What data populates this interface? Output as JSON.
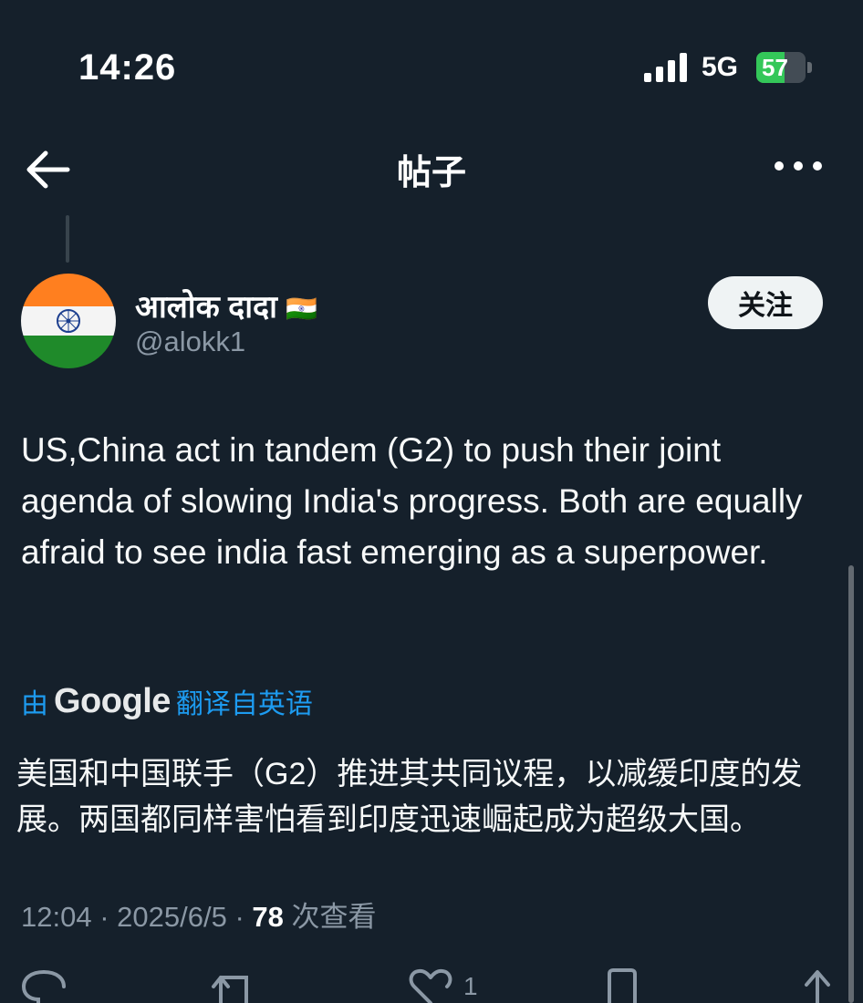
{
  "status_bar": {
    "time": "14:26",
    "network": "5G",
    "battery": "57",
    "battery_level": 0.57
  },
  "header": {
    "title": "帖子",
    "back_icon": "arrow-left-icon",
    "more_icon": "more-horizontal-icon"
  },
  "author": {
    "name": "आलोक दादा",
    "flag": "🇮🇳",
    "handle": "@alokk1",
    "follow_label": "关注",
    "avatar_icon": "india-flag-avatar"
  },
  "post": {
    "text": "US,China act in tandem (G2) to push their joint agenda of slowing India's progress. Both are equally afraid to see india fast emerging as a superpower."
  },
  "translation": {
    "by": "由",
    "provider": "Google",
    "label": "翻译自英语",
    "text": "美国和中国联手（G2）推进其共同议程，以减缓印度的发展。两国都同样害怕看到印度迅速崛起成为超级大国。"
  },
  "meta": {
    "time": "12:04",
    "sep1": "·",
    "date": "2025/6/5",
    "sep2": "·",
    "views": "78",
    "views_label": "次查看"
  },
  "actions": {
    "reply_icon": "reply-icon",
    "repost_icon": "repost-icon",
    "like_icon": "heart-icon",
    "like_count": "1",
    "bookmark_icon": "bookmark-icon",
    "share_icon": "share-icon"
  },
  "colors": {
    "background": "#15202b",
    "accent": "#1d9bf0",
    "muted": "#8b98a5",
    "battery": "#34c759"
  }
}
